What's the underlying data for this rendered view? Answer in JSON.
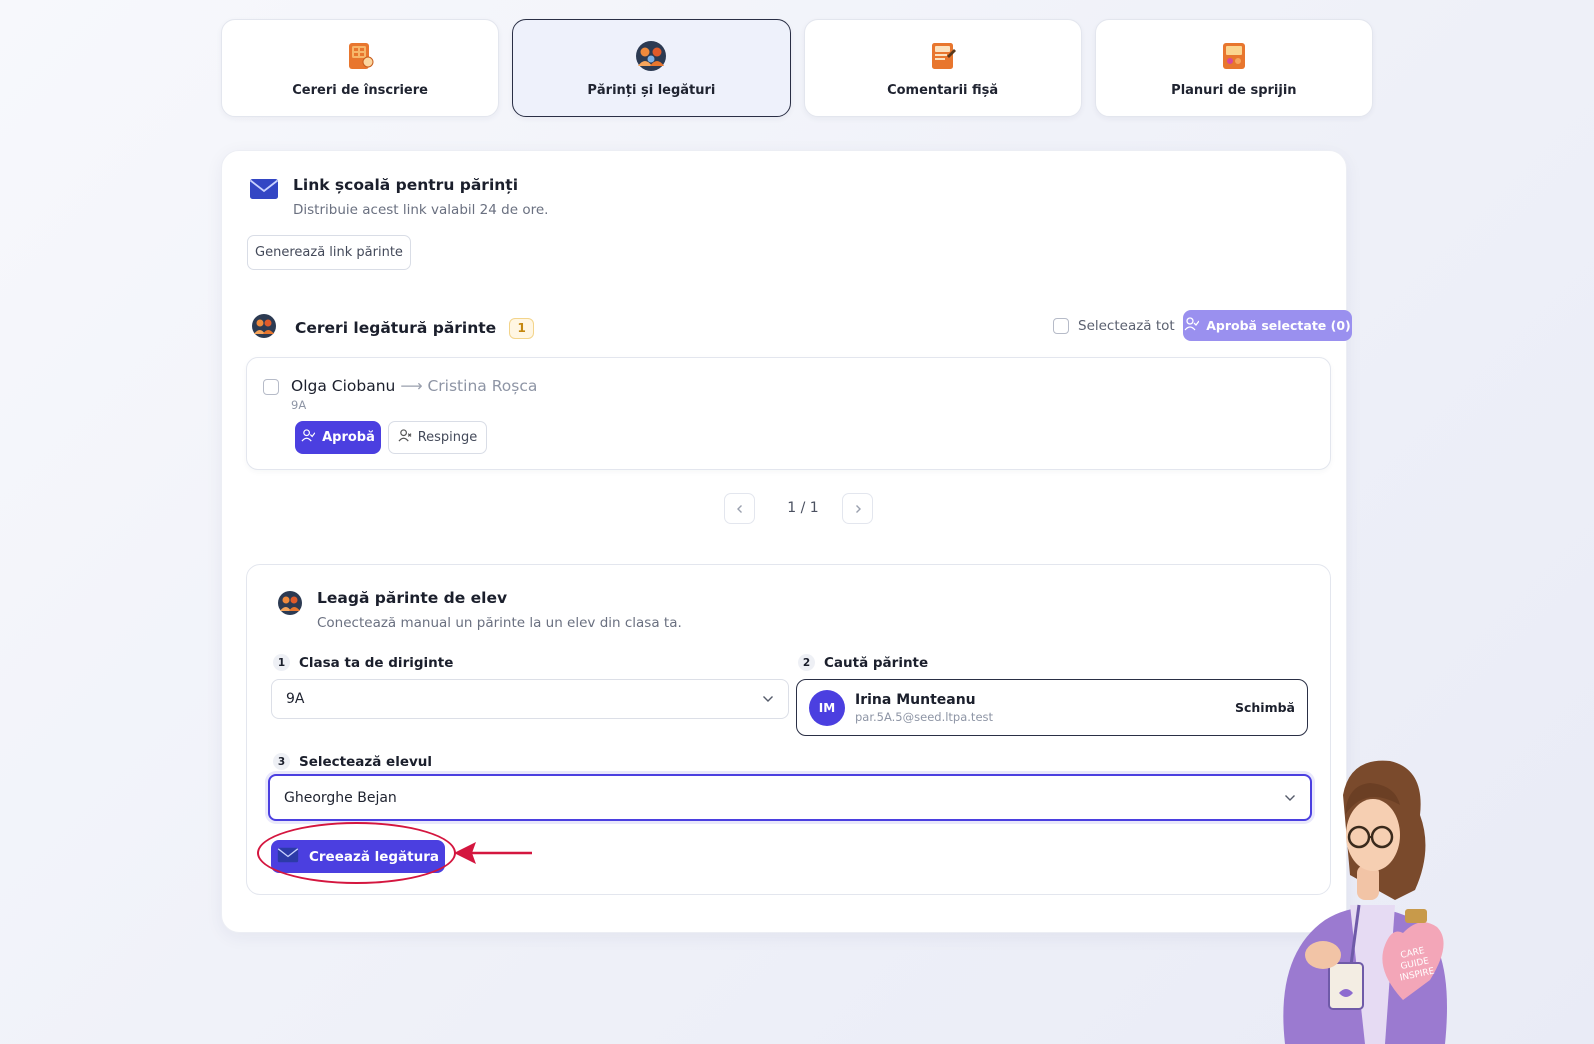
{
  "tabs": [
    {
      "label": "Cereri de înscriere",
      "icon": "enrollment-requests-icon",
      "active": false
    },
    {
      "label": "Părinți și legături",
      "icon": "parents-links-icon",
      "active": true
    },
    {
      "label": "Comentarii fișă",
      "icon": "sheet-comments-icon",
      "active": false
    },
    {
      "label": "Planuri de sprijin",
      "icon": "support-plans-icon",
      "active": false
    }
  ],
  "school_link": {
    "title": "Link școală pentru părinți",
    "subtitle": "Distribuie acest link valabil 24 de ore.",
    "generate_button": "Generează link părinte"
  },
  "requests": {
    "title": "Cereri legătură părinte",
    "count": "1",
    "select_all_label": "Selectează tot",
    "approve_selected_label": "Aprobă selectate (0)",
    "items": [
      {
        "parent": "Olga Ciobanu",
        "arrow": "⟶",
        "student": "Cristina Roșca",
        "class": "9A",
        "approve_label": "Aprobă",
        "reject_label": "Respinge"
      }
    ],
    "pagination": "1 / 1"
  },
  "link_form": {
    "title": "Leagă părinte de elev",
    "subtitle": "Conectează manual un părinte la un elev din clasa ta.",
    "step1": {
      "num": "1",
      "label": "Clasa ta de diriginte",
      "value": "9A"
    },
    "step2": {
      "num": "2",
      "label": "Caută părinte",
      "parent_initials": "IM",
      "parent_name": "Irina Munteanu",
      "parent_email": "par.5A.5@seed.ltpa.test",
      "change_label": "Schimbă"
    },
    "step3": {
      "num": "3",
      "label": "Selectează elevul",
      "value": "Gheorghe Bejan"
    },
    "create_button": "Creează legătura"
  },
  "mascot": {
    "badge_text": "CARE GUIDE INSPIRE"
  },
  "colors": {
    "accent": "#4b3fe0",
    "accent_disabled": "#9a90ef",
    "annotation": "#d4163f",
    "badge_bg": "#fff6e3"
  }
}
